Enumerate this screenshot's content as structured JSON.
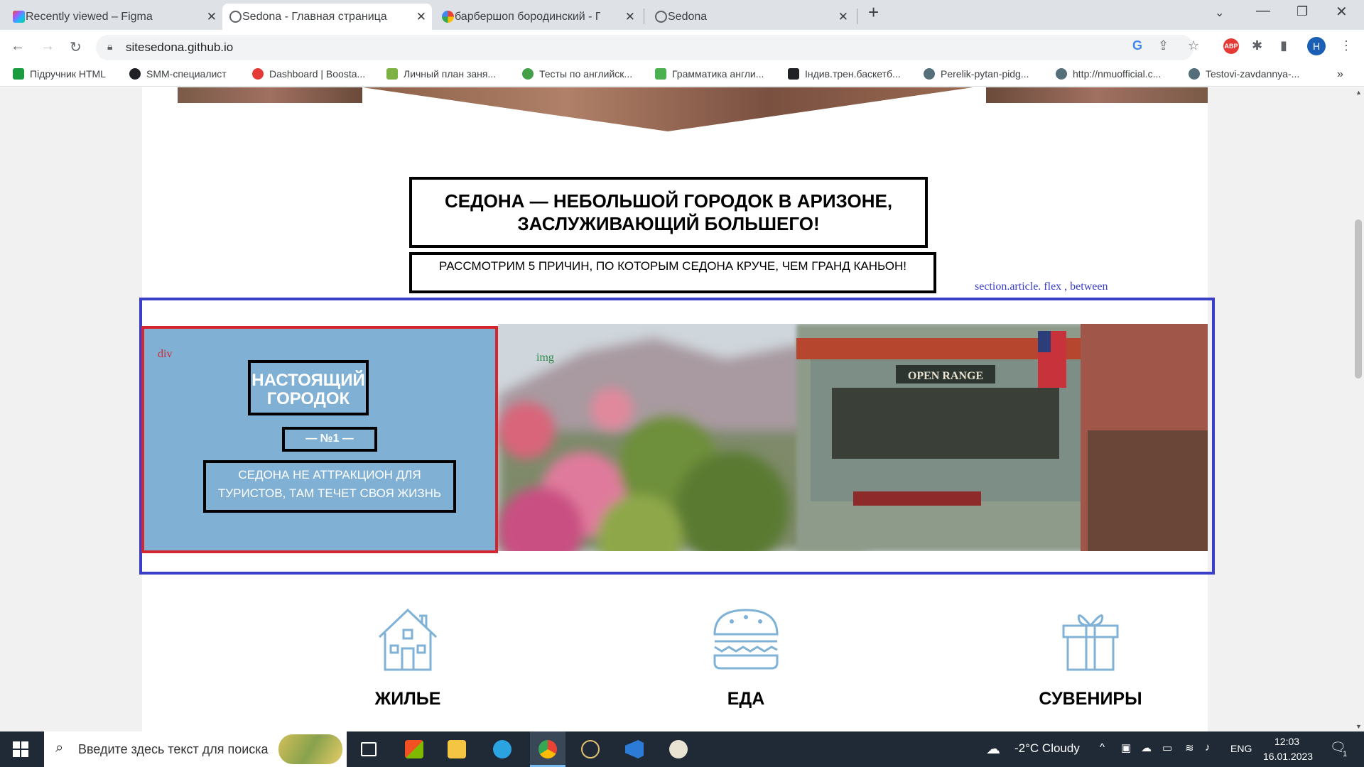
{
  "tabs": [
    {
      "label": "Recently viewed – Figma",
      "icon": "figma-icon",
      "color": "#f24e1e"
    },
    {
      "label": "Sedona - Главная страница",
      "icon": "globe-icon",
      "color": "#5f6368"
    },
    {
      "label": "барбершоп бородинский - Пои",
      "icon": "google-icon",
      "color": "#4285f4"
    },
    {
      "label": "Sedona",
      "icon": "globe-icon",
      "color": "#5f6368"
    }
  ],
  "address": {
    "url": "sitesedona.github.io"
  },
  "bookmarks": [
    {
      "label": "Підручник HTML",
      "color": "#1a9c3e"
    },
    {
      "label": "SMM-специалист",
      "color": "#202124"
    },
    {
      "label": "Dashboard | Boosta...",
      "color": "#e53935"
    },
    {
      "label": "Личный план заня...",
      "color": "#7cb342"
    },
    {
      "label": "Тесты по английск...",
      "color": "#43a047"
    },
    {
      "label": "Грамматика англи...",
      "color": "#4caf50"
    },
    {
      "label": "Індив.трен.баскетб...",
      "color": "#202124"
    },
    {
      "label": "Perelik-pytan-pidg...",
      "color": "#546e7a"
    },
    {
      "label": "http://nmuofficial.c...",
      "color": "#546e7a"
    },
    {
      "label": "Testovi-zavdannya-...",
      "color": "#546e7a"
    }
  ],
  "page": {
    "title": "СЕДОНА — НЕБОЛЬШОЙ ГОРОДОК В АРИЗОНЕ, ЗАСЛУЖИВАЮЩИЙ БОЛЬШЕГО!",
    "subtitle": "РАССМОТРИМ 5 ПРИЧИН, ПО КОТОРЫМ СЕДОНА КРУЧЕ, ЧЕМ ГРАНД КАНЬОН!",
    "section_note": "section.article. flex , between",
    "div_note": "div",
    "img_note": "img",
    "card": {
      "heading": "НАСТОЯЩИЙ ГОРОДОК",
      "number": "— №1 —",
      "text": "СЕДОНА НЕ АТТРАКЦИОН ДЛЯ ТУРИСТОВ, ТАМ ТЕЧЕТ СВОЯ ЖИЗНЬ"
    },
    "features": [
      {
        "label": "ЖИЛЬЕ",
        "icon": "house-icon"
      },
      {
        "label": "ЕДА",
        "icon": "burger-icon"
      },
      {
        "label": "СУВЕНИРЫ",
        "icon": "gift-icon"
      }
    ]
  },
  "taskbar": {
    "search_placeholder": "Введите здесь текст для поиска",
    "weather": "-2°C  Cloudy",
    "lang": "ENG",
    "time": "12:03",
    "date": "16.01.2023",
    "notif": "1"
  },
  "colors": {
    "section_border": "#3b3fc8",
    "div_border": "#d42630",
    "card_bg": "#80b0d4",
    "icon_stroke": "#7fb2d6"
  }
}
